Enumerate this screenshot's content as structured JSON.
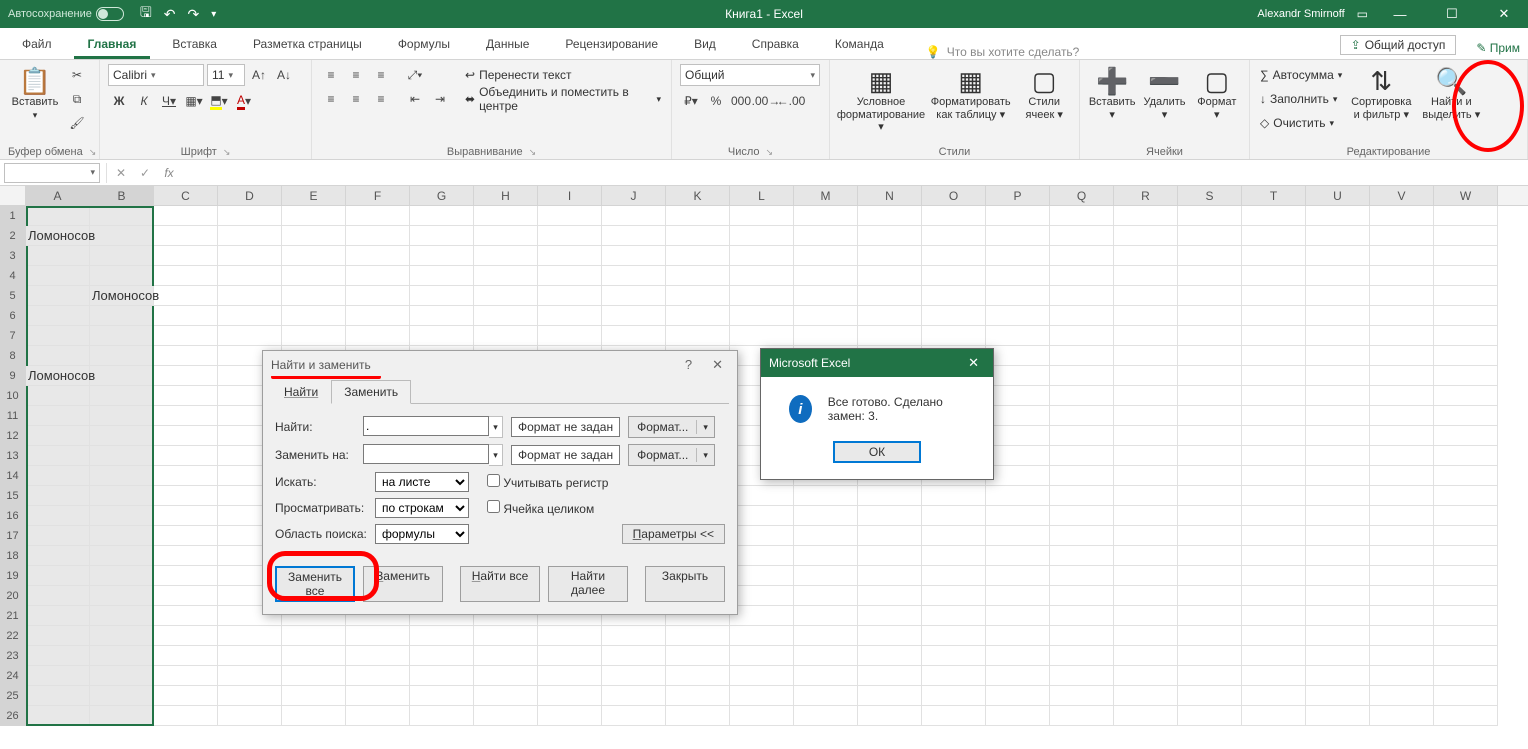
{
  "titlebar": {
    "autosave": "Автосохранение",
    "title": "Книга1 - Excel",
    "user": "Alexandr Smirnoff"
  },
  "tabs": {
    "file": "Файл",
    "home": "Главная",
    "insert": "Вставка",
    "page_layout": "Разметка страницы",
    "formulas": "Формулы",
    "data": "Данные",
    "review": "Рецензирование",
    "view": "Вид",
    "help": "Справка",
    "team": "Команда",
    "tellme": "Что вы хотите сделать?",
    "share": "Общий доступ",
    "notes": "Прим"
  },
  "ribbon": {
    "clipboard": {
      "paste": "Вставить",
      "group": "Буфер обмена"
    },
    "font": {
      "name": "Calibri",
      "size": "11",
      "group": "Шрифт",
      "bold": "Ж",
      "italic": "К",
      "underline": "Ч"
    },
    "align": {
      "wrap": "Перенести текст",
      "merge": "Объединить и поместить в центре",
      "group": "Выравнивание"
    },
    "number": {
      "format": "Общий",
      "group": "Число"
    },
    "styles": {
      "cond": "Условное форматирование",
      "table": "Форматировать как таблицу",
      "cell": "Стили ячеек",
      "group": "Стили"
    },
    "cells": {
      "insert": "Вставить",
      "delete": "Удалить",
      "format": "Формат",
      "group": "Ячейки"
    },
    "editing": {
      "sum": "Автосумма",
      "fill": "Заполнить",
      "clear": "Очистить",
      "sort": "Сортировка и фильтр",
      "find": "Найти и выделить",
      "group": "Редактирование"
    }
  },
  "grid": {
    "columns": [
      "A",
      "B",
      "C",
      "D",
      "E",
      "F",
      "G",
      "H",
      "I",
      "J",
      "K",
      "L",
      "M",
      "N",
      "O",
      "P",
      "Q",
      "R",
      "S",
      "T",
      "U",
      "V",
      "W"
    ],
    "rows": 26,
    "cells": {
      "A2": "Ломоносов",
      "B5": "Ломоносов",
      "A9": "Ломоносов"
    },
    "namebox": ""
  },
  "find_dlg": {
    "title": "Найти и заменить",
    "tab_find": "Найти",
    "tab_replace": "Заменить",
    "find_label": "Найти:",
    "replace_label": "Заменить на:",
    "find_value": ".",
    "replace_value": "",
    "format_unset": "Формат не задан",
    "format_btn": "Формат...",
    "search_in_label": "Искать:",
    "search_in": "на листе",
    "search_by_label": "Просматривать:",
    "search_by": "по строкам",
    "look_in_label": "Область поиска:",
    "look_in": "формулы",
    "match_case": "Учитывать регистр",
    "whole_cell": "Ячейка целиком",
    "options": "Параметры <<",
    "replace_all": "Заменить все",
    "replace": "Заменить",
    "find_all": "Найти все",
    "find_next": "Найти далее",
    "close": "Закрыть"
  },
  "msgbox": {
    "title": "Microsoft Excel",
    "message": "Все готово. Сделано замен: 3.",
    "ok": "ОК"
  }
}
